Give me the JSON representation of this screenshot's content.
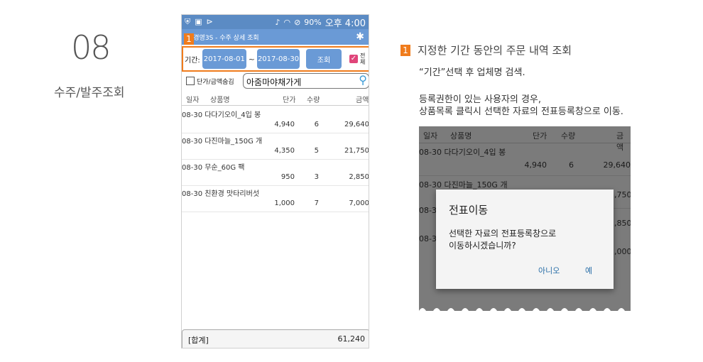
{
  "step": {
    "number": "08",
    "title": "수주/발주조회"
  },
  "phone": {
    "status": {
      "time": "오후 4:00",
      "battery": "90%"
    },
    "header": {
      "title": "년경영3S - 수주 상세 조회",
      "badge": "1"
    },
    "filter": {
      "period_label": "기간:",
      "start_date": "2017-08-01",
      "tilde": "~",
      "end_date": "2017-08-30",
      "search_button": "조회",
      "all_label": "전체"
    },
    "search": {
      "option_label": "단가/금액숨김",
      "value": "아줌마야채가게"
    },
    "columns": [
      "일자",
      "상품명",
      "단가",
      "수량",
      "금액"
    ],
    "rows": [
      {
        "name": "08-30 다다기오이_4입 봉",
        "price": "4,940",
        "qty": "6",
        "amount": "29,640"
      },
      {
        "name": "08-30 다진마늘_150G 개",
        "price": "4,350",
        "qty": "5",
        "amount": "21,750"
      },
      {
        "name": "08-30 무순_60G 팩",
        "price": "950",
        "qty": "3",
        "amount": "2,850"
      },
      {
        "name": "08-30 친환경 맛타리버섯",
        "price": "1,000",
        "qty": "7",
        "amount": "7,000"
      }
    ],
    "total": {
      "label": "[합계]",
      "value": "61,240"
    }
  },
  "note": {
    "badge": "1",
    "heading": "지정한 기간 동안의 주문 내역 조회",
    "line1": "“기간”선택 후 업체명 검색.",
    "line2": "등록권한이 있는 사용자의 경우,",
    "line3": "상품목록 클릭시 선택한 자료의 전표등록창으로 이동."
  },
  "screenshot": {
    "columns": [
      "일자",
      "상품명",
      "단가",
      "수량",
      "금액"
    ],
    "row1": {
      "name": "08-30 다다기오이_4입 봉",
      "price": "4,940",
      "qty": "6",
      "amount": "29,640"
    },
    "row2_name": "08-30 다진마늘_150G 개",
    "frag_a": "08-3",
    "frag_b": "08-3",
    "frag_c": ",750",
    "frag_d": ",850",
    "frag_e": ",000",
    "dialog": {
      "title": "전표이동",
      "message_1": "선택한 자료의 전표등록창으로",
      "message_2": "이동하시겠습니까?",
      "no": "아니오",
      "yes": "예"
    }
  }
}
